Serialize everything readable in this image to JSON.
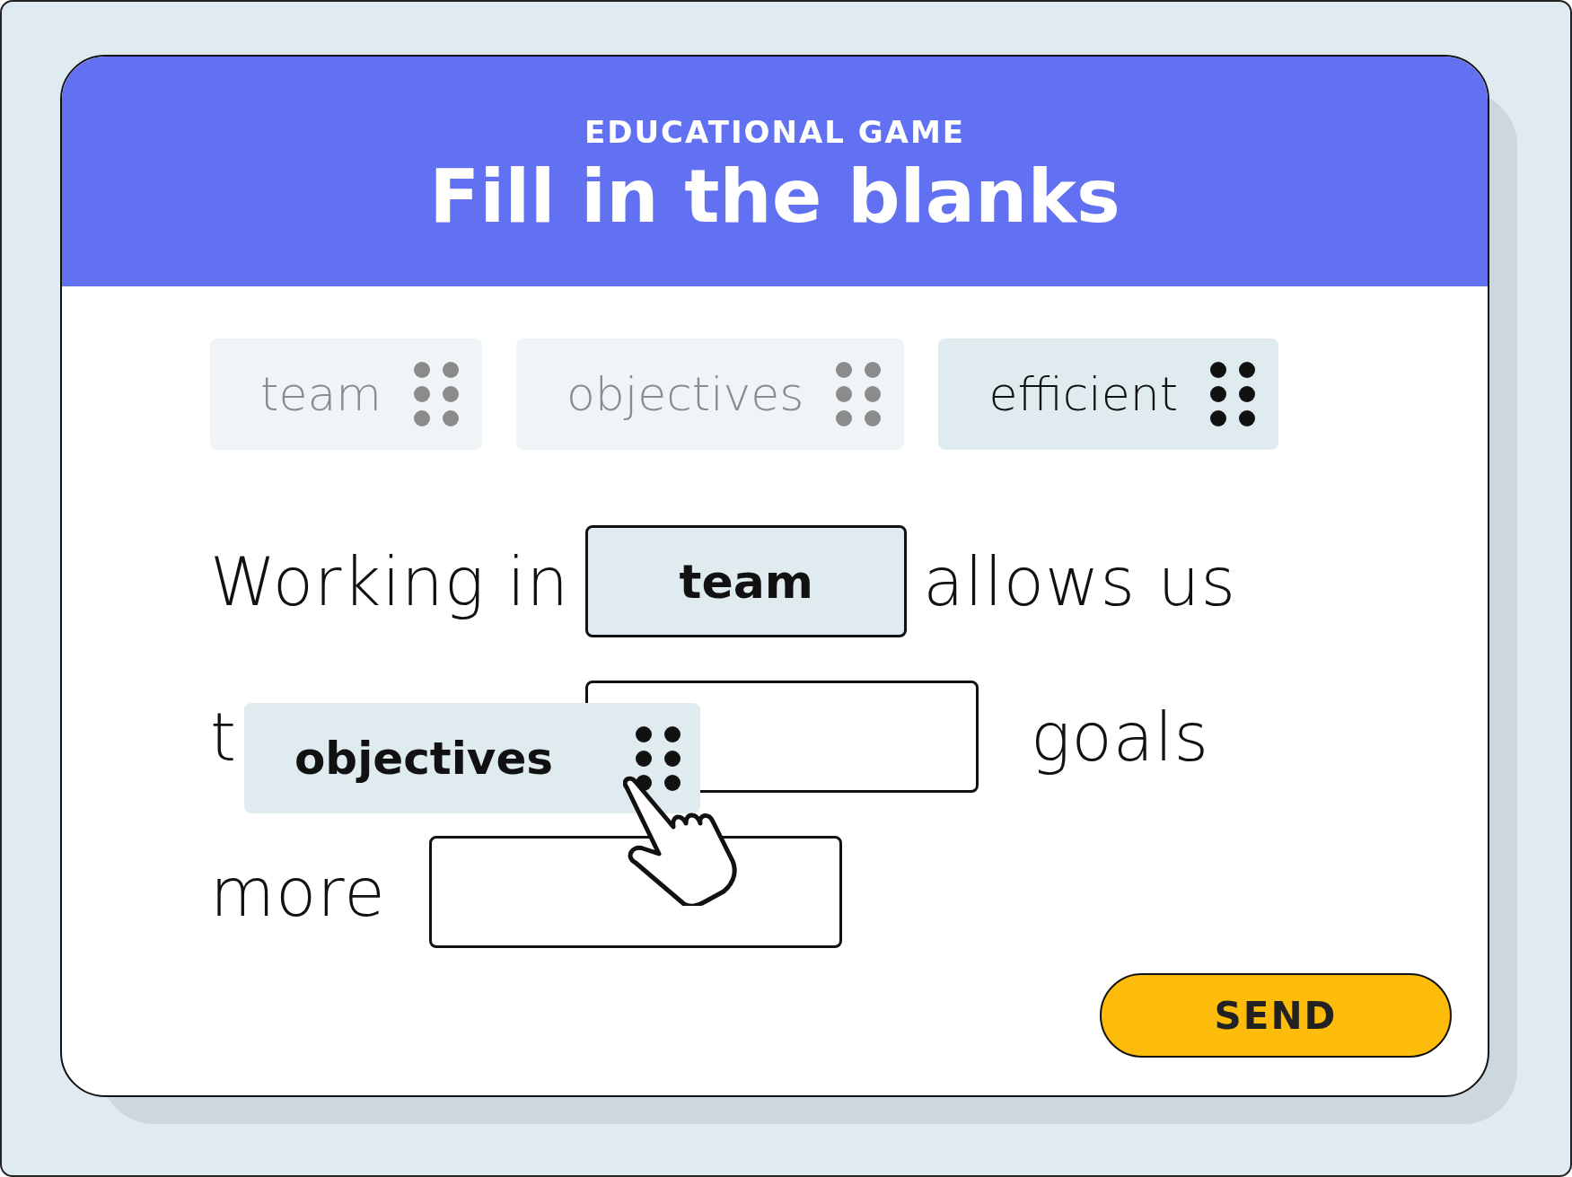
{
  "header": {
    "eyebrow": "EDUCATIONAL GAME",
    "title": "Fill in the blanks"
  },
  "word_chips": [
    {
      "label": "team",
      "used": true
    },
    {
      "label": "objectives",
      "used": true
    },
    {
      "label": "efficient",
      "used": false
    }
  ],
  "sentence_lines": [
    {
      "parts": [
        {
          "kind": "text",
          "text": "Working in"
        },
        {
          "kind": "blank",
          "value": "team"
        },
        {
          "kind": "text",
          "text": "allows us"
        }
      ]
    },
    {
      "parts": [
        {
          "kind": "text",
          "text": "t"
        },
        {
          "kind": "blank"
        },
        {
          "kind": "text",
          "text": "goals"
        }
      ]
    },
    {
      "parts": [
        {
          "kind": "text",
          "text": "more"
        },
        {
          "kind": "blank"
        }
      ]
    }
  ],
  "dragged_chip": {
    "label": "objectives"
  },
  "send_button": {
    "label": "SEND"
  }
}
